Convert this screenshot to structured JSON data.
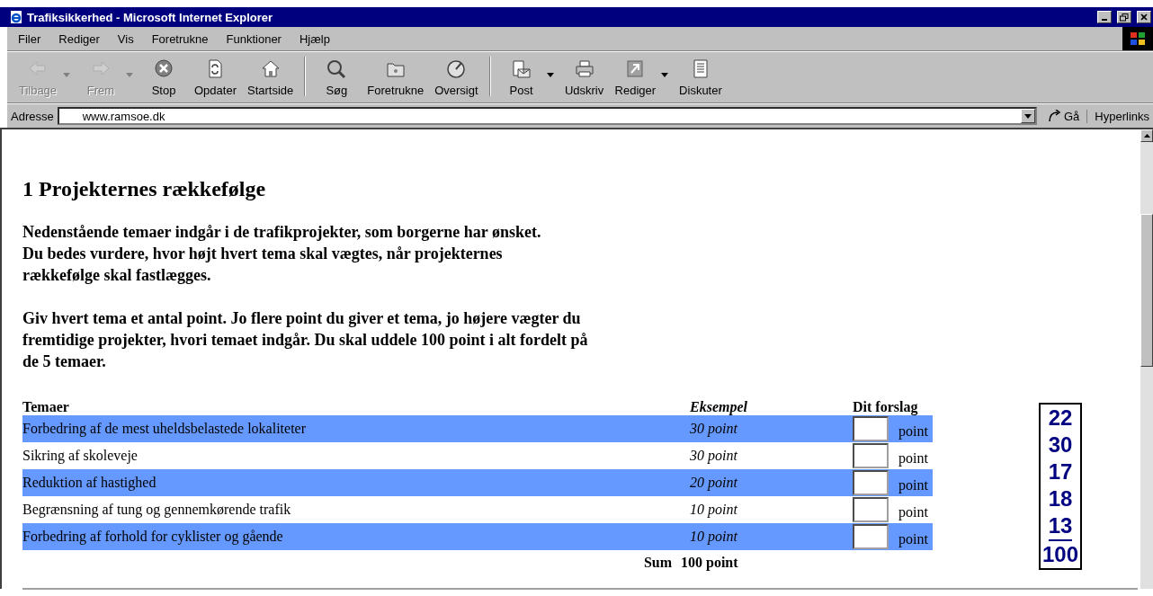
{
  "window": {
    "title": "Trafiksikkerhed - Microsoft Internet Explorer"
  },
  "menu": [
    "Filer",
    "Rediger",
    "Vis",
    "Foretrukne",
    "Funktioner",
    "Hjælp"
  ],
  "toolbar": [
    {
      "label": "Tilbage",
      "kind": "back",
      "disabled": true,
      "dropdown": true,
      "separator_after": false
    },
    {
      "label": "Frem",
      "kind": "forward",
      "disabled": true,
      "dropdown": true,
      "separator_after": false
    },
    {
      "label": "Stop",
      "kind": "stop",
      "disabled": false,
      "dropdown": false,
      "separator_after": false
    },
    {
      "label": "Opdater",
      "kind": "refresh",
      "disabled": false,
      "dropdown": false,
      "separator_after": false
    },
    {
      "label": "Startside",
      "kind": "home",
      "disabled": false,
      "dropdown": false,
      "separator_after": true
    },
    {
      "label": "Søg",
      "kind": "search",
      "disabled": false,
      "dropdown": false,
      "separator_after": false
    },
    {
      "label": "Foretrukne",
      "kind": "folder",
      "disabled": false,
      "dropdown": false,
      "separator_after": false
    },
    {
      "label": "Oversigt",
      "kind": "history",
      "disabled": false,
      "dropdown": false,
      "separator_after": true
    },
    {
      "label": "Post",
      "kind": "mail",
      "disabled": false,
      "dropdown": true,
      "separator_after": false
    },
    {
      "label": "Udskriv",
      "kind": "print",
      "disabled": false,
      "dropdown": false,
      "separator_after": false
    },
    {
      "label": "Rediger",
      "kind": "edit",
      "disabled": false,
      "dropdown": true,
      "separator_after": false
    },
    {
      "label": "Diskuter",
      "kind": "discuss",
      "disabled": false,
      "dropdown": false,
      "separator_after": false
    }
  ],
  "address": {
    "label": "Adresse",
    "value": "www.ramsoe.dk",
    "go": "Gå",
    "links": "Hyperlinks"
  },
  "page": {
    "heading": "1 Projekternes rækkefølge",
    "paragraphs": [
      {
        "lines": [
          "Nedenstående temaer indgår i de trafikprojekter, som borgerne har ønsket.",
          "Du bedes vurdere, hvor højt hvert tema skal vægtes, når projekternes",
          "rækkefølge skal fastlægges."
        ]
      },
      {
        "lines": [
          "Giv hvert tema et antal point. Jo flere point du giver et tema, jo højere vægter du",
          "fremtidige projekter, hvori temaet indgår. Du skal uddele 100 point i alt fordelt på",
          "de 5 temaer."
        ]
      }
    ],
    "table": {
      "columns": [
        "Temaer",
        "Eksempel",
        "Dit forslag"
      ],
      "rows": [
        {
          "theme": "Forbedring af de mest uheldsbelastede lokaliteter",
          "example": "30 point",
          "unit": "point",
          "highlighted": true
        },
        {
          "theme": "Sikring af skoleveje",
          "example": "30 point",
          "unit": "point",
          "highlighted": false
        },
        {
          "theme": "Reduktion af hastighed",
          "example": "20 point",
          "unit": "point",
          "highlighted": true
        },
        {
          "theme": "Begrænsning af tung og gennemkørende trafik",
          "example": "10 point",
          "unit": "point",
          "highlighted": false
        },
        {
          "theme": "Forbedring af forhold for cyklister og gående",
          "example": "10 point",
          "unit": "point",
          "highlighted": true
        }
      ],
      "sum_label": "Sum",
      "sum_value": "100 point"
    },
    "tally": {
      "values": [
        "22",
        "30",
        "17",
        "18",
        "13"
      ],
      "total": "100"
    }
  }
}
